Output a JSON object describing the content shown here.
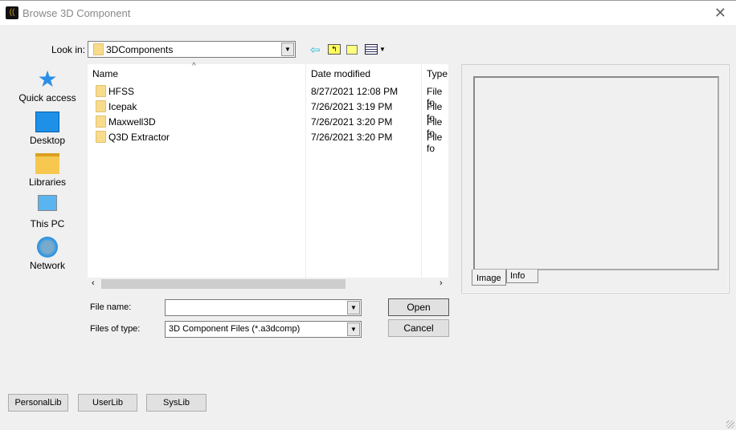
{
  "window": {
    "title": "Browse 3D Component",
    "close": "✕"
  },
  "look_in": {
    "label": "Look in:",
    "value": "3DComponents"
  },
  "toolbar": {
    "back": "back-icon",
    "up": "up-folder-icon",
    "new_folder": "new-folder-icon",
    "view": "view-menu-icon"
  },
  "places": [
    {
      "label": "Quick access"
    },
    {
      "label": "Desktop"
    },
    {
      "label": "Libraries"
    },
    {
      "label": "This PC"
    },
    {
      "label": "Network"
    }
  ],
  "columns": [
    "Name",
    "Date modified",
    "Type"
  ],
  "files": [
    {
      "name": "HFSS",
      "date": "8/27/2021 12:08 PM",
      "type": "File fo"
    },
    {
      "name": "Icepak",
      "date": "7/26/2021 3:19 PM",
      "type": "File fo"
    },
    {
      "name": "Maxwell3D",
      "date": "7/26/2021 3:20 PM",
      "type": "File fo"
    },
    {
      "name": "Q3D Extractor",
      "date": "7/26/2021 3:20 PM",
      "type": "File fo"
    }
  ],
  "file_name": {
    "label": "File name:",
    "value": ""
  },
  "file_type": {
    "label": "Files of type:",
    "value": "3D Component Files (*.a3dcomp)"
  },
  "buttons": {
    "open": "Open",
    "cancel": "Cancel",
    "personal": "PersonalLib",
    "user": "UserLib",
    "sys": "SysLib"
  },
  "preview_tabs": [
    "Image",
    "Info"
  ]
}
